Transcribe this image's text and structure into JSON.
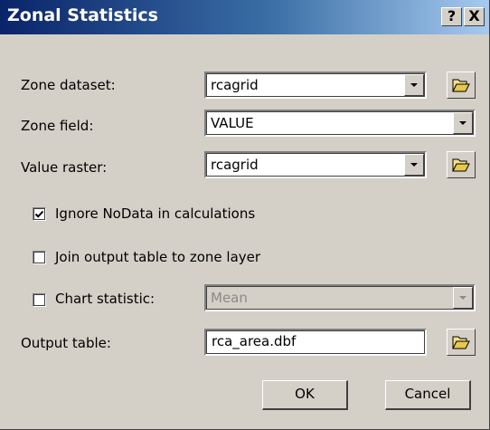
{
  "window": {
    "title": "Zonal Statistics",
    "help_label": "?",
    "close_label": "X"
  },
  "fields": {
    "zone_dataset": {
      "label": "Zone dataset:",
      "value": "rcagrid"
    },
    "zone_field": {
      "label": "Zone field:",
      "value": "VALUE"
    },
    "value_raster": {
      "label": "Value raster:",
      "value": "rcagrid"
    },
    "ignore_nodata": {
      "label": "Ignore NoData in calculations",
      "checked": true
    },
    "join_output": {
      "label": "Join output table to zone layer",
      "checked": false
    },
    "chart_statistic": {
      "label": "Chart statistic:",
      "checked": false,
      "value": "Mean",
      "enabled": false
    },
    "output_table": {
      "label": "Output table:",
      "value": "rca_area.dbf"
    }
  },
  "buttons": {
    "ok": "OK",
    "cancel": "Cancel"
  },
  "icons": {
    "browse": "open-folder-icon",
    "dropdown": "chevron-down-icon",
    "check": "check-icon"
  }
}
